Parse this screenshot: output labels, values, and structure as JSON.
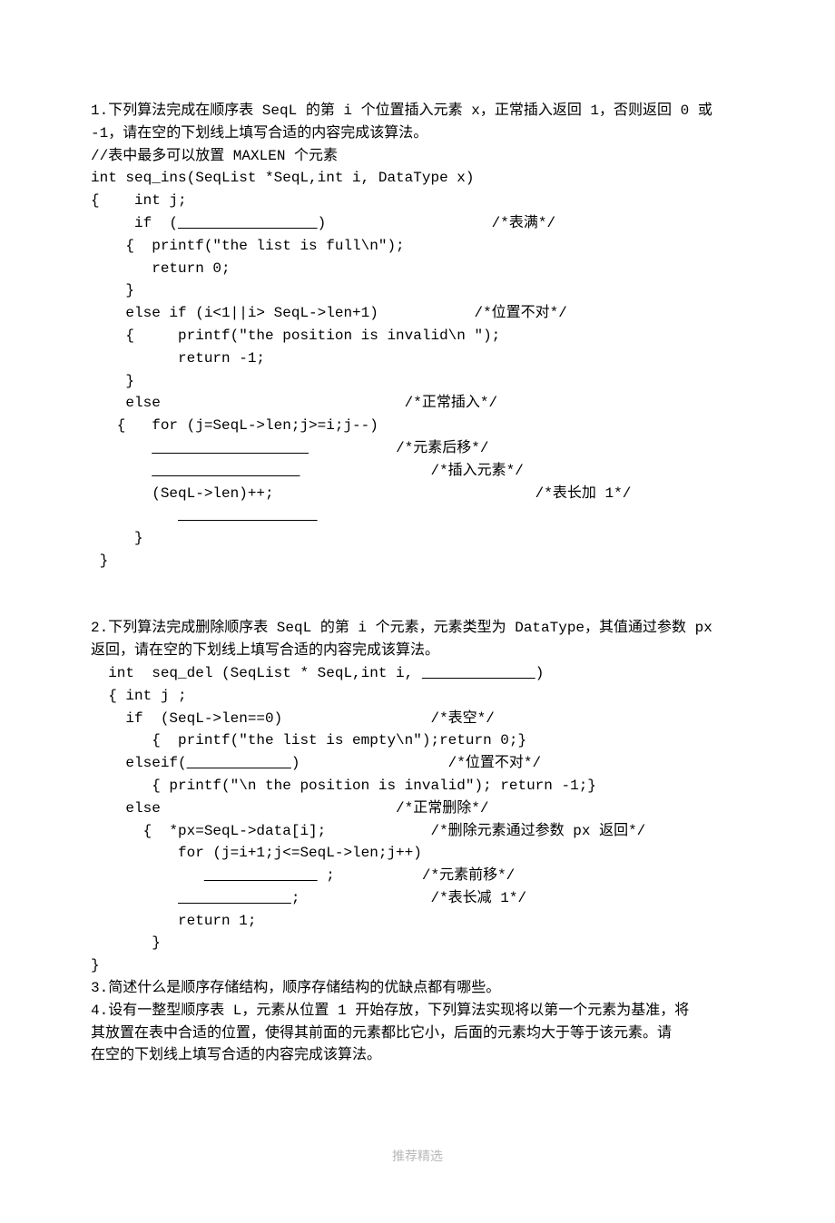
{
  "q1": {
    "intro1": "1.下列算法完成在顺序表 SeqL 的第 i 个位置插入元素 x，正常插入返回 1，否则返回 0 或",
    "intro2": "-1，请在空的下划线上填写合适的内容完成该算法。",
    "comment_max": "//表中最多可以放置 MAXLEN 个元素",
    "sig": "int seq_ins(SeqList *SeqL,int i, DataType x)",
    "open": "{    int j;",
    "if_prefix": "     if  (",
    "if_blank": "                ",
    "if_suffix": ")                   /*表满*/",
    "full_print": "    {  printf(\"the list is full\\n\");",
    "return0": "       return 0;",
    "close1": "    }",
    "elseif": "    else if (i<1||i> SeqL->len+1)           /*位置不对*/",
    "pos_print": "    {     printf(\"the position is invalid\\n \");",
    "return_neg1": "          return -1;",
    "close2": "    }",
    "else_line": "    else                            /*正常插入*/",
    "for_line": "   {   for (j=SeqL->len;j>=i;j--)",
    "blank_shift_pre": "       ",
    "blank_shift": "                  ",
    "blank_shift_suf": "          /*元素后移*/",
    "blank_insert_pre": "       ",
    "blank_insert": "                 ",
    "blank_insert_suf": "               /*插入元素*/",
    "lenpp": "       (SeqL->len)++;                              /*表长加 1*/",
    "blank_extra_pre": "          ",
    "blank_extra": "                ",
    "close3": "     }",
    "close4": " }"
  },
  "q2": {
    "intro1": "2.下列算法完成删除顺序表 SeqL 的第 i 个元素，元素类型为 DataType，其值通过参数 px",
    "intro2": "返回，请在空的下划线上填写合适的内容完成该算法。",
    "sig_pre": "  int  seq_del (SeqList * SeqL,int i, ",
    "sig_blank": "             ",
    "sig_suf": ")",
    "open": "  { int j ;",
    "if_empty": "    if  (SeqL->len==0)                 /*表空*/",
    "empty_print": "       {  printf(\"the list is empty\\n\");return 0;}",
    "elseif_pre": "    elseif(",
    "elseif_blank": "            ",
    "elseif_suf": ")                 /*位置不对*/",
    "pos_print": "       { printf(\"\\n the position is invalid\"); return -1;}",
    "else_line": "    else                           /*正常删除*/",
    "px_line": "      {  *px=SeqL->data[i];            /*删除元素通过参数 px 返回*/",
    "for_line": "          for (j=i+1;j<=SeqL->len;j++)",
    "blank_move_pre": "             ",
    "blank_move": "             ",
    "blank_move_suf": " ;          /*元素前移*/",
    "blank_dec_pre": "          ",
    "blank_dec": "             ",
    "blank_dec_suf": ";               /*表长减 1*/",
    "return1": "          return 1;",
    "close1": "       }",
    "close2": "}"
  },
  "q3": "3.简述什么是顺序存储结构，顺序存储结构的优缺点都有哪些。",
  "q4": {
    "l1": "4.设有一整型顺序表 L，元素从位置 1 开始存放，下列算法实现将以第一个元素为基准，将",
    "l2": "其放置在表中合适的位置，使得其前面的元素都比它小，后面的元素均大于等于该元素。请",
    "l3": "在空的下划线上填写合适的内容完成该算法。"
  },
  "footer": "推荐精选"
}
